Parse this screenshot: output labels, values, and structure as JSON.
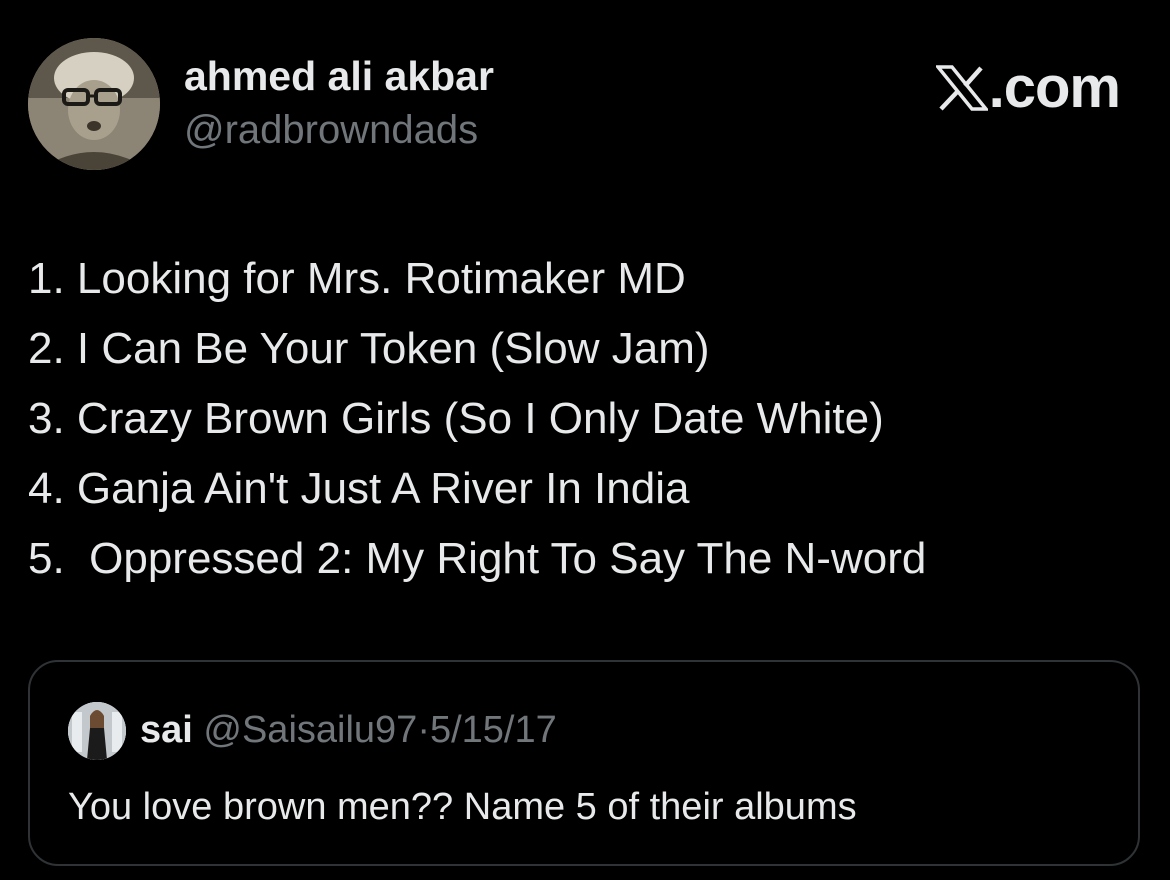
{
  "tweet": {
    "author": {
      "display_name": "ahmed ali akbar",
      "handle": "@radbrowndads"
    },
    "brand": {
      "text": ".com",
      "icon": "x-logo-icon"
    },
    "lines": [
      "1. Looking for Mrs. Rotimaker MD",
      "2. I Can Be Your Token (Slow Jam)",
      "3. Crazy Brown Girls (So I Only Date White)",
      "4. Ganja Ain't Just A River In India",
      "5.  Oppressed 2: My Right To Say The N-word"
    ]
  },
  "quoted_tweet": {
    "display_name": "sai",
    "handle": "@Saisailu97",
    "separator": "·",
    "date": "5/15/17",
    "text": "You love brown men?? Name 5 of their albums"
  },
  "colors": {
    "background": "#000000",
    "primary_text": "#e7e9ea",
    "secondary_text": "#71767b",
    "border": "#2f3336"
  }
}
